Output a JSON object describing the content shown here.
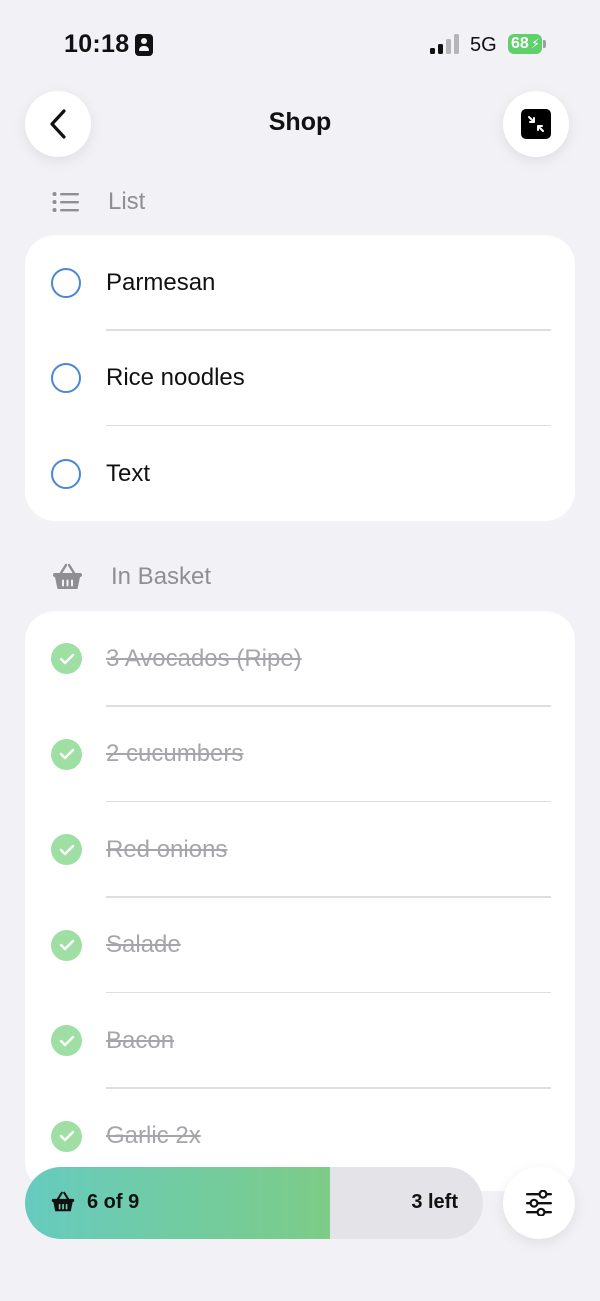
{
  "status_bar": {
    "time": "10:18",
    "network": "5G",
    "battery": "68"
  },
  "nav": {
    "title": "Shop"
  },
  "list_section": {
    "title": "List",
    "items": [
      {
        "label": "Parmesan"
      },
      {
        "label": "Rice noodles"
      },
      {
        "label": "Text"
      }
    ]
  },
  "basket_section": {
    "title": "In Basket",
    "items": [
      {
        "label": "3 Avocados (Ripe)"
      },
      {
        "label": "2 cucumbers"
      },
      {
        "label": "Red onions"
      },
      {
        "label": "Salade"
      },
      {
        "label": "Bacon"
      },
      {
        "label": "Garlic 2x"
      }
    ]
  },
  "progress": {
    "label": "6 of 9",
    "remaining": "3 left",
    "fraction": 0.667
  },
  "colors": {
    "accent_blue": "#4a86d8",
    "check_green": "#9fdfa4",
    "progress_start": "#66cbbf",
    "progress_end": "#7dcc87",
    "background": "#f1f1f6"
  }
}
